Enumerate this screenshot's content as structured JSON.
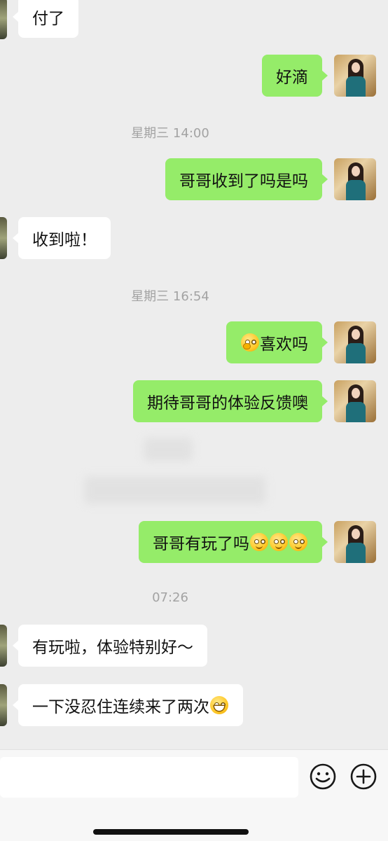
{
  "messages": {
    "m1": "付了",
    "m2": "好滴",
    "m3": "哥哥收到了吗是吗",
    "m4": "收到啦！",
    "m5": "喜欢吗",
    "m6": "期待哥哥的体验反馈噢",
    "m7": "哥哥有玩了吗",
    "m8": "有玩啦，体验特别好～",
    "m9": "一下没忍住连续来了两次"
  },
  "timestamps": {
    "t1": "星期三 14:00",
    "t2": "星期三 16:54",
    "t3": "07:26"
  },
  "emoji": {
    "m5_prefix": "wave-emoji",
    "m7_suffix": [
      "flushed-emoji",
      "flushed-emoji",
      "flushed-emoji"
    ],
    "m9_suffix": "grin-emoji"
  },
  "input": {
    "value": "",
    "placeholder": ""
  },
  "colors": {
    "background": "#ededed",
    "my_bubble": "#95ec69",
    "their_bubble": "#ffffff",
    "timestamp": "#a3a3a3"
  }
}
